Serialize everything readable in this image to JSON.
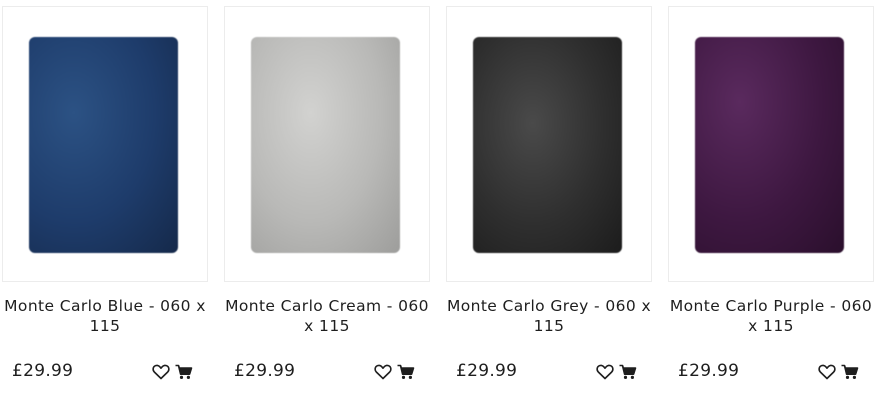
{
  "products": [
    {
      "title": "Monte Carlo Blue - 060 x 115",
      "price": "£29.99",
      "color_name": "blue",
      "colors": [
        "#1e3c6b",
        "#2c5284",
        "#15294a"
      ],
      "wishlist_icon": "heart-outline-icon",
      "cart_icon": "shopping-cart-icon"
    },
    {
      "title": "Monte Carlo Cream - 060 x 115",
      "price": "£29.99",
      "color_name": "cream",
      "colors": [
        "#b9b9b7",
        "#d2d2d0",
        "#9d9d9b"
      ],
      "wishlist_icon": "heart-outline-icon",
      "cart_icon": "shopping-cart-icon"
    },
    {
      "title": "Monte Carlo Grey - 060 x 115",
      "price": "£29.99",
      "color_name": "grey",
      "colors": [
        "#2f2f2f",
        "#4a4a4a",
        "#1c1c1c"
      ],
      "wishlist_icon": "heart-outline-icon",
      "cart_icon": "shopping-cart-icon"
    },
    {
      "title": "Monte Carlo Purple - 060 x 115",
      "price": "£29.99",
      "color_name": "purple",
      "colors": [
        "#3e1841",
        "#5a2a5e",
        "#2a0f2c"
      ],
      "wishlist_icon": "heart-outline-icon",
      "cart_icon": "shopping-cart-icon"
    }
  ]
}
